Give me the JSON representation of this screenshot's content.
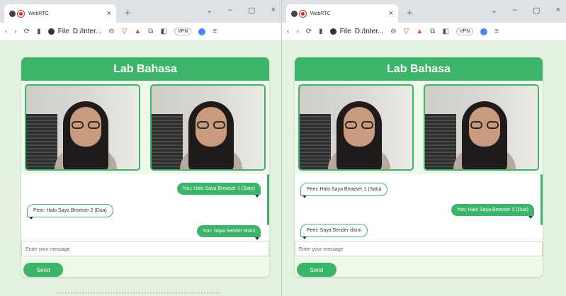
{
  "browser": {
    "tab_title": "WebRTC",
    "tab_close": "×",
    "new_tab": "+",
    "win_ctl": [
      "⌄",
      "–",
      "▢",
      "×"
    ],
    "nav": [
      "‹",
      "›",
      "⟳",
      "▮"
    ],
    "file_label": "File",
    "address": "D:/Inter...",
    "vpn_label": "VPN",
    "icons": [
      "zoom-icon",
      "brave-shields-icon",
      "bat-rewards-icon",
      "extensions-icon",
      "sidebar-icon",
      "wallet-icon",
      "share-icon",
      "vpn-icon",
      "leo-icon",
      "menu-icon"
    ]
  },
  "app": {
    "title": "Lab Bahasa",
    "accent": "#3cb46a",
    "input_placeholder": "Enter your message",
    "send_label": "Send"
  },
  "windows": [
    {
      "messages": [
        {
          "from": "you",
          "text": "You: Halo Saya Browser 1 (Satu)"
        },
        {
          "from": "peer",
          "text": "Peer: Halo Saya Browser 2 (Dua)"
        },
        {
          "from": "you",
          "text": "You: Saya Sender disini"
        }
      ]
    },
    {
      "messages": [
        {
          "from": "peer",
          "text": "Peer: Halo Saya Browser 1 (Satu)"
        },
        {
          "from": "you",
          "text": "You: Halo Saya Browser 2 (Dua)"
        },
        {
          "from": "peer",
          "text": "Peer: Saya Sender disini"
        }
      ]
    }
  ]
}
